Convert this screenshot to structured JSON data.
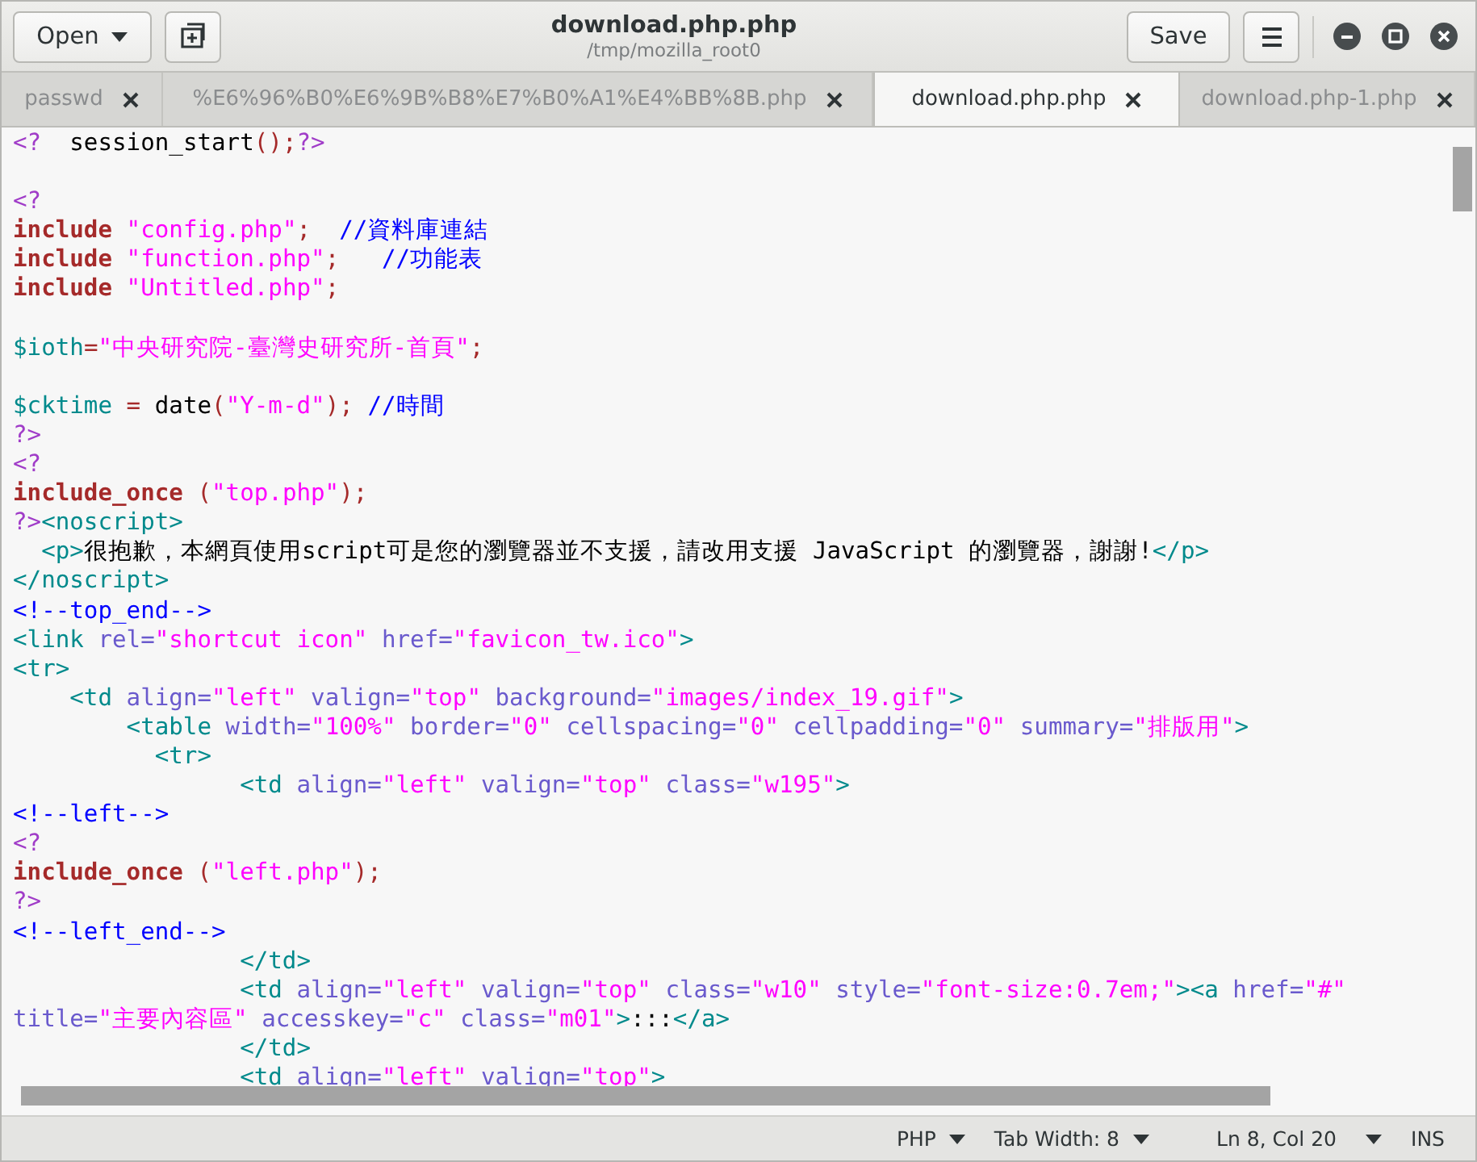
{
  "window": {
    "title": "download.php.php",
    "subtitle": "/tmp/mozilla_root0"
  },
  "header": {
    "open_label": "Open",
    "save_label": "Save"
  },
  "tabs": [
    {
      "label": "passwd",
      "selected": false
    },
    {
      "label": "%E6%96%B0%E6%9B%B8%E7%B0%A1%E4%BB%8B.php",
      "selected": false
    },
    {
      "label": "download.php.php",
      "selected": true
    },
    {
      "label": "download.php-1.php",
      "selected": false
    }
  ],
  "code_lines": [
    {
      "kind": "code",
      "tokens": [
        {
          "kind": "php",
          "text": "<?"
        },
        {
          "kind": "plain",
          "text": "  session_start"
        },
        {
          "kind": "punct",
          "text": "();"
        },
        {
          "kind": "php",
          "text": "?>"
        }
      ]
    },
    {
      "kind": "blank"
    },
    {
      "kind": "code",
      "tokens": [
        {
          "kind": "php",
          "text": "<?"
        }
      ]
    },
    {
      "kind": "code",
      "tokens": [
        {
          "kind": "keyword",
          "text": "include"
        },
        {
          "kind": "string",
          "text": " \"config.php\""
        },
        {
          "kind": "punct",
          "text": ";"
        },
        {
          "kind": "comment",
          "text": "  //資料庫連結"
        }
      ]
    },
    {
      "kind": "code",
      "tokens": [
        {
          "kind": "keyword",
          "text": "include"
        },
        {
          "kind": "string",
          "text": " \"function.php\""
        },
        {
          "kind": "punct",
          "text": ";"
        },
        {
          "kind": "comment",
          "text": "   //功能表"
        }
      ]
    },
    {
      "kind": "code",
      "tokens": [
        {
          "kind": "keyword",
          "text": "include"
        },
        {
          "kind": "string",
          "text": " \"Untitled.php\""
        },
        {
          "kind": "punct",
          "text": ";"
        }
      ]
    },
    {
      "kind": "blank"
    },
    {
      "kind": "code",
      "tokens": [
        {
          "kind": "variable",
          "text": "$ioth"
        },
        {
          "kind": "punct",
          "text": "="
        },
        {
          "kind": "string",
          "text": "\"中央研究院-臺灣史研究所-首頁\""
        },
        {
          "kind": "punct",
          "text": ";"
        }
      ]
    },
    {
      "kind": "blank"
    },
    {
      "kind": "code",
      "tokens": [
        {
          "kind": "variable",
          "text": "$cktime"
        },
        {
          "kind": "punct",
          "text": " ="
        },
        {
          "kind": "plain",
          "text": " date"
        },
        {
          "kind": "punct",
          "text": "("
        },
        {
          "kind": "string",
          "text": "\"Y-m-d\""
        },
        {
          "kind": "punct",
          "text": ");"
        },
        {
          "kind": "comment",
          "text": " //時間"
        }
      ]
    },
    {
      "kind": "code",
      "tokens": [
        {
          "kind": "php",
          "text": "?>"
        }
      ]
    },
    {
      "kind": "code",
      "tokens": [
        {
          "kind": "php",
          "text": "<?"
        }
      ]
    },
    {
      "kind": "code",
      "tokens": [
        {
          "kind": "keyword",
          "text": "include_once"
        },
        {
          "kind": "punct",
          "text": " ("
        },
        {
          "kind": "string",
          "text": "\"top.php\""
        },
        {
          "kind": "punct",
          "text": ");"
        }
      ]
    },
    {
      "kind": "code",
      "tokens": [
        {
          "kind": "php",
          "text": "?>"
        },
        {
          "kind": "tag",
          "text": "<noscript>"
        }
      ]
    },
    {
      "kind": "code",
      "tokens": [
        {
          "kind": "tag",
          "text": "  <p>"
        },
        {
          "kind": "plain",
          "text": "很抱歉，本網頁使用script可是您的瀏覽器並不支援，請改用支援 JavaScript 的瀏覽器，謝謝!"
        },
        {
          "kind": "tag",
          "text": "</p>"
        }
      ]
    },
    {
      "kind": "code",
      "tokens": [
        {
          "kind": "tag",
          "text": "</noscript>"
        }
      ]
    },
    {
      "kind": "code",
      "tokens": [
        {
          "kind": "comment",
          "text": "<!--top_end-->"
        }
      ]
    },
    {
      "kind": "code",
      "tokens": [
        {
          "kind": "tag",
          "text": "<link"
        },
        {
          "kind": "attr",
          "text": " rel="
        },
        {
          "kind": "string",
          "text": "\"shortcut icon\""
        },
        {
          "kind": "attr",
          "text": " href="
        },
        {
          "kind": "string",
          "text": "\"favicon_tw.ico\""
        },
        {
          "kind": "tag",
          "text": ">"
        }
      ]
    },
    {
      "kind": "code",
      "tokens": [
        {
          "kind": "tag",
          "text": "<tr>"
        }
      ]
    },
    {
      "kind": "code",
      "tokens": [
        {
          "kind": "tag",
          "text": "    <td"
        },
        {
          "kind": "attr",
          "text": " align="
        },
        {
          "kind": "string",
          "text": "\"left\""
        },
        {
          "kind": "attr",
          "text": " valign="
        },
        {
          "kind": "string",
          "text": "\"top\""
        },
        {
          "kind": "attr",
          "text": " background="
        },
        {
          "kind": "string",
          "text": "\"images/index_19.gif\""
        },
        {
          "kind": "tag",
          "text": ">"
        }
      ]
    },
    {
      "kind": "code",
      "tokens": [
        {
          "kind": "tag",
          "text": "        <table"
        },
        {
          "kind": "attr",
          "text": " width="
        },
        {
          "kind": "string",
          "text": "\"100%\""
        },
        {
          "kind": "attr",
          "text": " border="
        },
        {
          "kind": "string",
          "text": "\"0\""
        },
        {
          "kind": "attr",
          "text": " cellspacing="
        },
        {
          "kind": "string",
          "text": "\"0\""
        },
        {
          "kind": "attr",
          "text": " cellpadding="
        },
        {
          "kind": "string",
          "text": "\"0\""
        },
        {
          "kind": "attr",
          "text": " summary="
        },
        {
          "kind": "string",
          "text": "\"排版用\""
        },
        {
          "kind": "tag",
          "text": ">"
        }
      ]
    },
    {
      "kind": "code",
      "tokens": [
        {
          "kind": "tag",
          "text": "          <tr>"
        }
      ]
    },
    {
      "kind": "code",
      "tokens": [
        {
          "kind": "tag",
          "text": "                <td"
        },
        {
          "kind": "attr",
          "text": " align="
        },
        {
          "kind": "string",
          "text": "\"left\""
        },
        {
          "kind": "attr",
          "text": " valign="
        },
        {
          "kind": "string",
          "text": "\"top\""
        },
        {
          "kind": "attr",
          "text": " class="
        },
        {
          "kind": "string",
          "text": "\"w195\""
        },
        {
          "kind": "tag",
          "text": ">"
        }
      ]
    },
    {
      "kind": "code",
      "tokens": [
        {
          "kind": "comment",
          "text": "<!--left-->"
        }
      ]
    },
    {
      "kind": "code",
      "tokens": [
        {
          "kind": "php",
          "text": "<?"
        }
      ]
    },
    {
      "kind": "code",
      "tokens": [
        {
          "kind": "keyword",
          "text": "include_once"
        },
        {
          "kind": "punct",
          "text": " ("
        },
        {
          "kind": "string",
          "text": "\"left.php\""
        },
        {
          "kind": "punct",
          "text": ");"
        }
      ]
    },
    {
      "kind": "code",
      "tokens": [
        {
          "kind": "php",
          "text": "?>"
        }
      ]
    },
    {
      "kind": "code",
      "tokens": [
        {
          "kind": "comment",
          "text": "<!--left_end-->"
        }
      ]
    },
    {
      "kind": "code",
      "tokens": [
        {
          "kind": "tag",
          "text": "                </td>"
        }
      ]
    },
    {
      "kind": "code",
      "tokens": [
        {
          "kind": "tag",
          "text": "                <td"
        },
        {
          "kind": "attr",
          "text": " align="
        },
        {
          "kind": "string",
          "text": "\"left\""
        },
        {
          "kind": "attr",
          "text": " valign="
        },
        {
          "kind": "string",
          "text": "\"top\""
        },
        {
          "kind": "attr",
          "text": " class="
        },
        {
          "kind": "string",
          "text": "\"w10\""
        },
        {
          "kind": "attr",
          "text": " style="
        },
        {
          "kind": "string",
          "text": "\"font-size:0.7em;\""
        },
        {
          "kind": "tag",
          "text": "><a"
        },
        {
          "kind": "attr",
          "text": " href="
        },
        {
          "kind": "string",
          "text": "\"#\""
        }
      ]
    },
    {
      "kind": "code",
      "tokens": [
        {
          "kind": "attr",
          "text": "title="
        },
        {
          "kind": "string",
          "text": "\"主要內容區\""
        },
        {
          "kind": "attr",
          "text": " accesskey="
        },
        {
          "kind": "string",
          "text": "\"c\""
        },
        {
          "kind": "attr",
          "text": " class="
        },
        {
          "kind": "string",
          "text": "\"m01\""
        },
        {
          "kind": "tag",
          "text": ">"
        },
        {
          "kind": "plain",
          "text": ":::"
        },
        {
          "kind": "tag",
          "text": "</a>"
        }
      ]
    },
    {
      "kind": "code",
      "tokens": [
        {
          "kind": "tag",
          "text": "                </td>"
        }
      ]
    },
    {
      "kind": "code",
      "tokens": [
        {
          "kind": "tag",
          "text": "                <td"
        },
        {
          "kind": "attr",
          "text": " align="
        },
        {
          "kind": "string",
          "text": "\"left\""
        },
        {
          "kind": "attr",
          "text": " valign="
        },
        {
          "kind": "string",
          "text": "\"top\""
        },
        {
          "kind": "tag",
          "text": ">"
        }
      ]
    }
  ],
  "status_bar": {
    "language": "PHP",
    "tab_width": "Tab Width: 8",
    "position": "Ln 8, Col 20",
    "mode": "INS"
  }
}
